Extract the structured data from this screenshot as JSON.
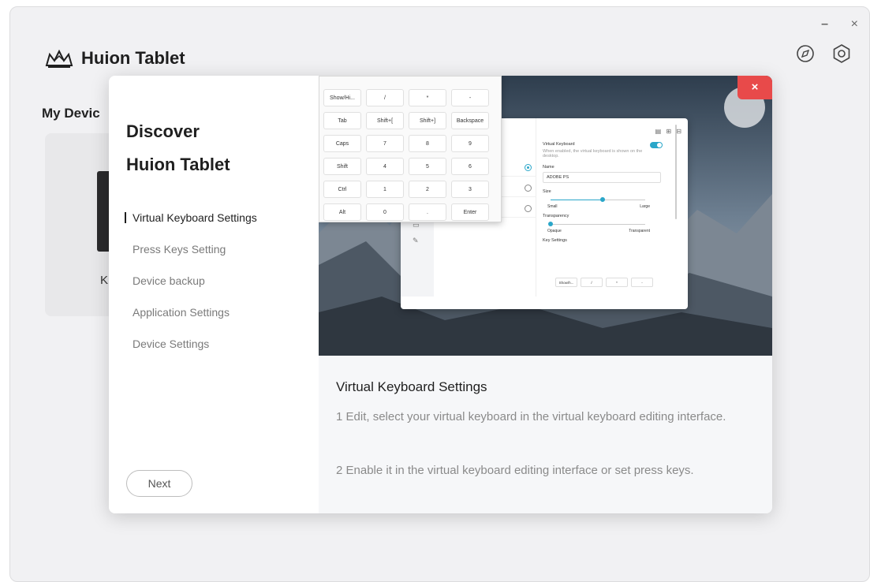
{
  "window": {
    "minimize_label": "–",
    "close_label": "×"
  },
  "header": {
    "title": "Huion Tablet",
    "compass_icon": "compass-icon",
    "settings_icon": "gear-icon",
    "logo_icon": "huion-crown-logo-icon"
  },
  "main": {
    "section_title": "My Devic",
    "device_label": "K"
  },
  "dialog": {
    "heading_line1": "Discover",
    "heading_line2": "Huion Tablet",
    "nav": [
      {
        "label": "Virtual Keyboard Settings",
        "active": true
      },
      {
        "label": "Press Keys Setting",
        "active": false
      },
      {
        "label": "Device backup",
        "active": false
      },
      {
        "label": "Application Settings",
        "active": false
      },
      {
        "label": "Device Settings",
        "active": false
      }
    ],
    "next_label": "Next",
    "close_label": "×",
    "caption_title": "Virtual Keyboard Settings",
    "caption_1": "1 Edit, select your virtual keyboard in the virtual keyboard editing interface.",
    "caption_2": "2 Enable it in the virtual keyboard editing interface or set press keys.",
    "preview": {
      "vk_keys": [
        "Show/Hi...",
        "/",
        "*",
        "-",
        "Tab",
        "Shift+[",
        "Shift+]",
        "Backspace",
        "Caps",
        "7",
        "8",
        "9",
        "Shift",
        "4",
        "5",
        "6",
        "Ctrl",
        "1",
        "2",
        "3",
        "Alt",
        "0",
        ".",
        "Enter"
      ],
      "editor": {
        "virtual_keyboard_label": "Virtual Keyboard",
        "virtual_keyboard_desc": "When enabled, the virtual keyboard is shown on the desktop.",
        "name_label": "Name",
        "name_value": "ADOBE PS",
        "size_label": "Size",
        "size_min": "Small",
        "size_max": "Large",
        "size_level": 0.55,
        "transparency_label": "Transparency",
        "transparency_min": "Opaque",
        "transparency_max": "Transparent",
        "transparency_level": 0.0,
        "key_settings_label": "Key Settings",
        "key_settings_keys": [
          "Show/h...",
          "/",
          "*",
          "-"
        ],
        "list_radios": [
          true,
          false,
          false
        ]
      }
    }
  }
}
